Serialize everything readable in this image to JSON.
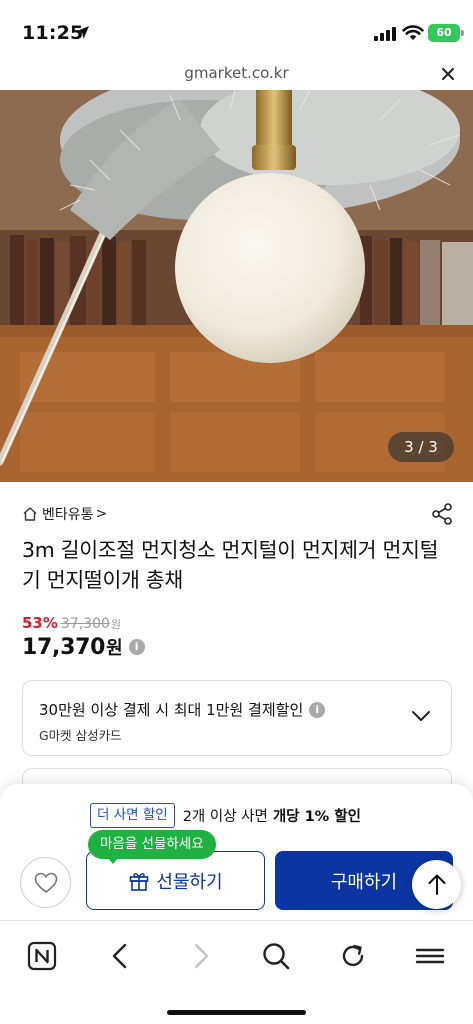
{
  "status_bar": {
    "time": "11:25",
    "battery": "60",
    "icons": [
      "location-arrow-icon",
      "signal-icon",
      "wifi-icon",
      "battery-icon"
    ]
  },
  "browser": {
    "url": "gmarket.co.kr",
    "close_icon": "close-icon"
  },
  "hero": {
    "image_counter": "3 / 3"
  },
  "product": {
    "shop_name": "벤타유통",
    "shop_chevron": ">",
    "title": "3m 길이조절 먼지청소 먼지털이 먼지제거 먼지털기 먼지떨이개 총채",
    "discount": "53%",
    "original_price": "37,300",
    "original_currency": "원",
    "price": "17,370",
    "currency": "원",
    "info_glyph": "i"
  },
  "payment_card": {
    "title": "30만원 이상 결제 시 최대 1만원 결제할인",
    "subtitle": "G마켓 삼성카드",
    "info_glyph": "i"
  },
  "purchase_bar": {
    "promo_badge": "더 사면 할인",
    "promo_text": "2개 이상 사면",
    "promo_bold": "개당 1% 할인",
    "gift_tooltip": "마음을 선물하세요",
    "gift_button": "선물하기",
    "buy_button": "구매하기"
  },
  "colors": {
    "accent_blue": "#0a35a3",
    "discount_red": "#e0192b",
    "tooltip_green": "#1fb242",
    "battery_green": "#34c759"
  }
}
